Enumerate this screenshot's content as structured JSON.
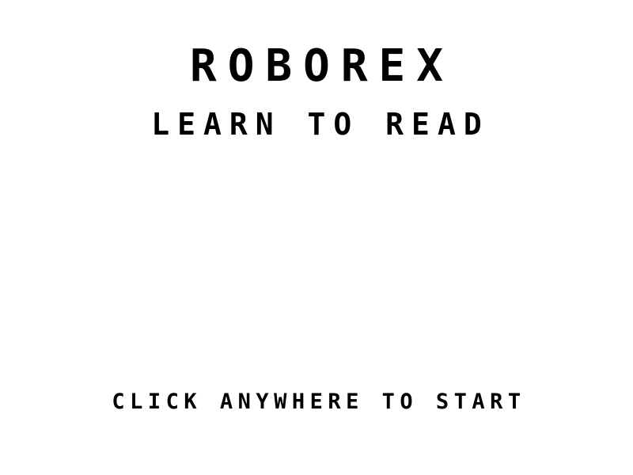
{
  "game": {
    "title": "ROBOREX",
    "subtitle": "LEARN TO READ",
    "start_prompt": "CLICK ANYWHERE TO START"
  },
  "colors": {
    "background": "#ffffff",
    "text": "#000000"
  }
}
